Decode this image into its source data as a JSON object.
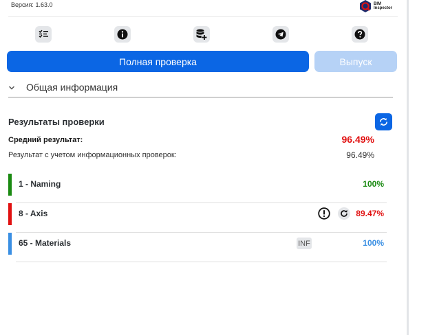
{
  "header": {
    "version_label": "Версия:",
    "version_value": "1.63.0",
    "logo_text_line1": "BIM",
    "logo_text_line2": "Inspector"
  },
  "toolbar": {
    "icons": [
      "checklist-icon",
      "info-icon",
      "database-add-icon",
      "telegram-icon",
      "help-icon"
    ]
  },
  "actions": {
    "full_check_label": "Полная проверка",
    "release_label": "Выпуск"
  },
  "accordion": {
    "label": "Общая информация"
  },
  "results": {
    "title": "Результаты проверки",
    "average_label": "Средний результат:",
    "average_value": "96.49%",
    "with_info_label": "Результат с учетом информационных проверок:",
    "with_info_value": "96.49%"
  },
  "checks": [
    {
      "name": "1 - Naming",
      "percent": "100%",
      "color": "#1a8a12"
    },
    {
      "name": "8 - Axis",
      "percent": "89.47%",
      "color": "#e11111"
    },
    {
      "name": "65 - Materials",
      "percent": "100%",
      "color": "#3a8fe3",
      "badge": "INF"
    }
  ],
  "colors": {
    "primary": "#0b66e4",
    "primary_disabled": "#b6d2f6",
    "danger": "#e11111",
    "success": "#1a8a12",
    "info": "#3a8fe3"
  }
}
